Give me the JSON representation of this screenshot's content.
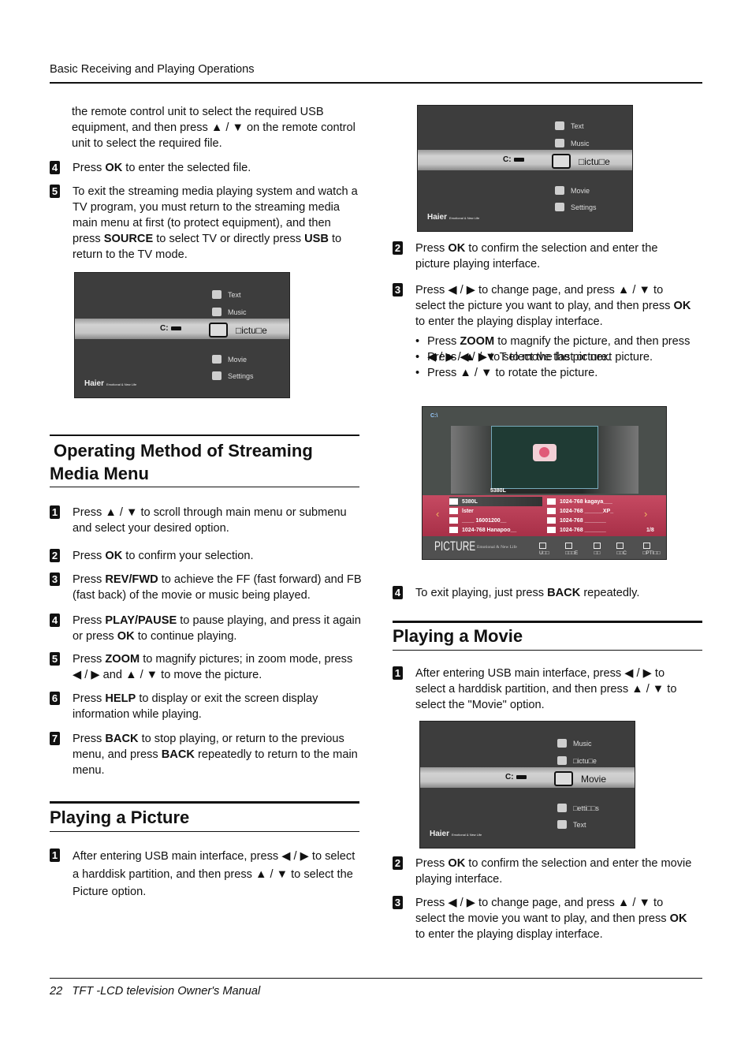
{
  "header": {
    "title": "Basic Receiving and Playing Operations"
  },
  "footer": {
    "page": "22",
    "title": "TFT -LCD  television  Owner's Manual"
  },
  "left": {
    "intro": [
      {
        "t": "the remote control unit to select the required USB equipment, and then press ▲ / ▼  on the remote control unit to select the required file."
      }
    ],
    "steps_top": [
      {
        "n": "4",
        "text": [
          {
            "t": "Press "
          },
          {
            "t": "OK",
            "b": true
          },
          {
            "t": " to enter the selected file."
          }
        ]
      },
      {
        "n": "5",
        "text": [
          {
            "t": "To exit the streaming media playing system and watch a TV program, you must return to the streaming media main menu at first (to protect equipment), and then press "
          },
          {
            "t": "SOURCE",
            "b": true
          },
          {
            "t": " to select TV or directly press "
          },
          {
            "t": "USB",
            "b": true
          },
          {
            "t": " to return to the TV mode."
          }
        ]
      }
    ],
    "menu1": {
      "items_above": [
        "Text",
        "Music"
      ],
      "selected": "□ictu□e",
      "items_below": [
        "Movie",
        "Settings"
      ],
      "drive": "C:",
      "logo": "Haier",
      "tagline": "Emotional & New Life"
    },
    "section1": {
      "title": "Operating Method of Streaming Media Menu",
      "steps": [
        {
          "n": "1",
          "text": [
            {
              "t": "Press  ▲ / ▼  to scroll through main menu or submenu and select your desired option."
            }
          ]
        },
        {
          "n": "2",
          "text": [
            {
              "t": "Press "
            },
            {
              "t": "OK",
              "b": true
            },
            {
              "t": " to confirm your selection."
            }
          ]
        },
        {
          "n": "3",
          "text": [
            {
              "t": "Press "
            },
            {
              "t": "REV/FWD",
              "b": true
            },
            {
              "t": " to achieve the FF (fast forward) and FB (fast back) of the movie or music being played."
            }
          ]
        },
        {
          "n": "4",
          "text": [
            {
              "t": "Press "
            },
            {
              "t": "PLAY/PAUSE",
              "b": true
            },
            {
              "t": " to pause playing, and press it again or press "
            },
            {
              "t": "OK",
              "b": true
            },
            {
              "t": " to continue playing."
            }
          ]
        },
        {
          "n": "5",
          "text": [
            {
              "t": "Press "
            },
            {
              "t": "ZOOM",
              "b": true
            },
            {
              "t": " to magnify pictures; in zoom mode, press  ◀ / ▶  and  ▲ / ▼  to move the picture."
            }
          ]
        },
        {
          "n": "6",
          "text": [
            {
              "t": "Press "
            },
            {
              "t": "HELP",
              "b": true
            },
            {
              "t": " to display or exit the screen display information while playing."
            }
          ]
        },
        {
          "n": "7",
          "text": [
            {
              "t": "Press "
            },
            {
              "t": "BACK",
              "b": true
            },
            {
              "t": " to stop playing, or return to the previous menu, and press "
            },
            {
              "t": "BACK",
              "b": true
            },
            {
              "t": " repeatedly to return to the main menu."
            }
          ]
        }
      ]
    },
    "section2": {
      "title": "Playing a Picture",
      "steps": [
        {
          "n": "1",
          "text": [
            {
              "t": "After entering USB main interface, press  ◀ / ▶  to select a harddisk partition, and then press ▲ / ▼  to select the Picture option."
            }
          ]
        }
      ]
    }
  },
  "right": {
    "menu2": {
      "items_above": [
        "Text",
        "Music"
      ],
      "selected": "□ictu□e",
      "items_below": [
        "Movie",
        "Settings"
      ],
      "drive": "C:",
      "logo": "Haier",
      "tagline": "Emotional & New Life"
    },
    "steps": [
      {
        "n": "2",
        "text": [
          {
            "t": "Press "
          },
          {
            "t": "OK",
            "b": true
          },
          {
            "t": " to confirm the selection and enter the picture playing interface."
          }
        ]
      },
      {
        "n": "3",
        "text": [
          {
            "t": "Press  ◀ / ▶  to change page, and press  ▲ / ▼  to select the picture you want to play, and then press "
          },
          {
            "t": "OK",
            "b": true
          },
          {
            "t": " to enter the playing display interface."
          }
        ]
      }
    ],
    "bullets": [
      [
        {
          "t": "Press "
        },
        {
          "t": "ZOOM",
          "b": true
        },
        {
          "t": " to magnify the picture, and then press  ◀ / ▶  / ▲ / ▼  T to move the picture."
        }
      ],
      [
        {
          "t": "Press  ◀ / ▶  to select the last or next picture."
        }
      ],
      [
        {
          "t": "Press  ▲ / ▼  to rotate the picture."
        }
      ]
    ],
    "photo": {
      "path": "C:\\",
      "preview_name": "5380L",
      "files_left": [
        "5380L",
        "lster",
        "____  16001200__",
        "1024-768 Hanapoo__"
      ],
      "files_right": [
        "1024-768 kagaya___",
        "1024-768 ______XP_",
        "1024-768 _______",
        "1024-768 _______"
      ],
      "page": "1/8",
      "title": "PICTURE",
      "tagline": "Emotional & New Life",
      "hints": [
        "U□□",
        "□□□E",
        "□□",
        "□□C",
        "□PTI□□"
      ]
    },
    "step4": {
      "n": "4",
      "text": [
        {
          "t": "To exit playing, just press "
        },
        {
          "t": "BACK",
          "b": true
        },
        {
          "t": " repeatedly."
        }
      ]
    },
    "section3": {
      "title": "Playing a Movie",
      "steps": [
        {
          "n": "1",
          "text": [
            {
              "t": "After entering USB main interface, press  ◀ / ▶  to select a harddisk partition, and then press  ▲ / ▼  to select the \"Movie\" option."
            }
          ]
        },
        {
          "n": "2",
          "text": [
            {
              "t": "Press "
            },
            {
              "t": "OK",
              "b": true
            },
            {
              "t": " to confirm the selection and enter the movie playing interface."
            }
          ]
        },
        {
          "n": "3",
          "text": [
            {
              "t": "Press  ◀ / ▶  to change page, and press  ▲ / ▼  to select the movie you want to play, and then press "
            },
            {
              "t": "OK",
              "b": true
            },
            {
              "t": " to enter the playing display interface."
            }
          ]
        }
      ]
    },
    "menu3": {
      "items_above": [
        "Music",
        "□ictu□e"
      ],
      "selected": "Movie",
      "items_below": [
        "□etti□□s",
        "Text"
      ],
      "drive": "C:",
      "logo": "Haier",
      "tagline": "Emotional & New Life"
    }
  }
}
